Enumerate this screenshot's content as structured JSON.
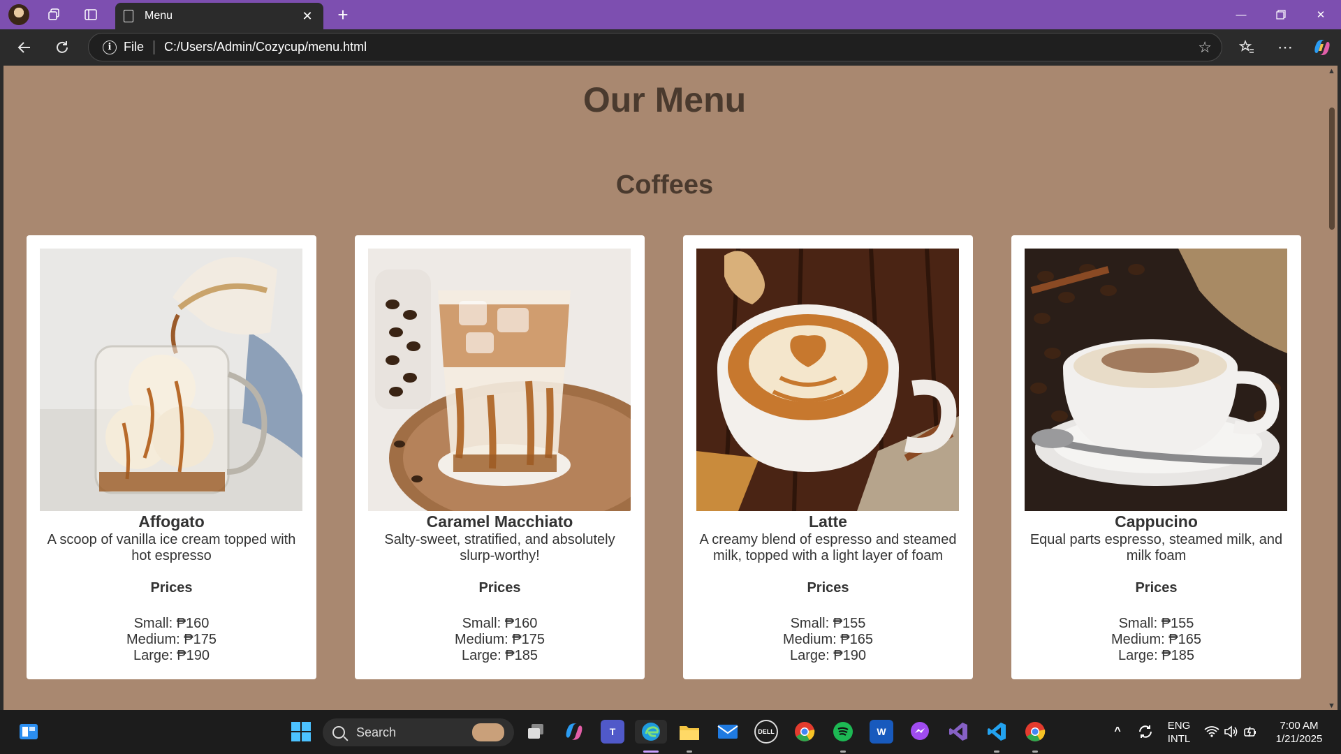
{
  "browser": {
    "tab_title": "Menu",
    "address_scheme": "File",
    "address_url": "C:/Users/Admin/Cozycup/menu.html"
  },
  "page": {
    "title": "Our Menu",
    "section_title": "Coffees",
    "prices_heading": "Prices",
    "items": [
      {
        "name": "Affogato",
        "description": "A scoop of vanilla ice cream topped with hot espresso",
        "small": "Small: ₱160",
        "medium": "Medium: ₱175",
        "large": "Large: ₱190",
        "image": "affogato-photo"
      },
      {
        "name": "Caramel Macchiato",
        "description": "Salty-sweet, stratified, and absolutely slurp-worthy!",
        "small": "Small: ₱160",
        "medium": "Medium: ₱175",
        "large": "Large: ₱185",
        "image": "iced-caramel-macchiato-photo"
      },
      {
        "name": "Latte",
        "description": "A creamy blend of espresso and steamed milk, topped with a light layer of foam",
        "small": "Small: ₱155",
        "medium": "Medium: ₱165",
        "large": "Large: ₱190",
        "image": "latte-art-cup-photo"
      },
      {
        "name": "Cappucino",
        "description": "Equal parts espresso, steamed milk, and milk foam",
        "small": "Small: ₱155",
        "medium": "Medium: ₱165",
        "large": "Large: ₱185",
        "image": "cappuccino-cup-photo"
      }
    ]
  },
  "taskbar": {
    "search_label": "Search",
    "lang_top": "ENG",
    "lang_bottom": "INTL",
    "time": "7:00 AM",
    "date": "1/21/2025"
  },
  "colors": {
    "titlebar": "#7d4fb0",
    "page_bg": "#a98870",
    "heading": "#4a3a2e"
  }
}
